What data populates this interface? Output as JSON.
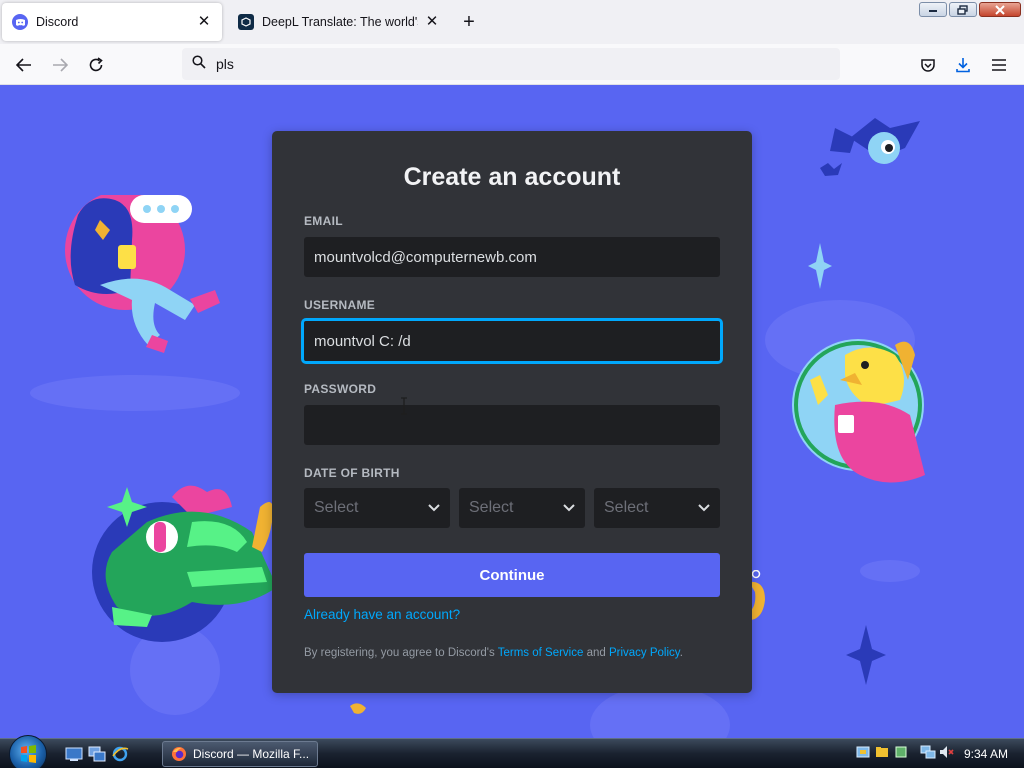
{
  "browser": {
    "tabs": [
      {
        "title": "Discord",
        "active": true
      },
      {
        "title": "DeepL Translate: The world's m",
        "active": false
      }
    ],
    "url": "pls"
  },
  "form": {
    "title": "Create an account",
    "email_label": "EMAIL",
    "email_value": "mountvolcd@computernewb.com",
    "username_label": "USERNAME",
    "username_value": "mountvol C: /d",
    "password_label": "PASSWORD",
    "password_value": "",
    "dob_label": "DATE OF BIRTH",
    "dob_selects": [
      "Select",
      "Select",
      "Select"
    ],
    "continue_label": "Continue",
    "login_link": "Already have an account?",
    "legal_prefix": "By registering, you agree to Discord's ",
    "terms_link": "Terms of Service",
    "legal_and": " and ",
    "privacy_link": "Privacy Policy",
    "legal_suffix": "."
  },
  "taskbar": {
    "window_title": "Discord — Mozilla F...",
    "clock": "9:34 AM"
  },
  "colors": {
    "brand": "#5865f2",
    "card": "#313338",
    "input": "#1e1f22",
    "link": "#00a8fc"
  }
}
